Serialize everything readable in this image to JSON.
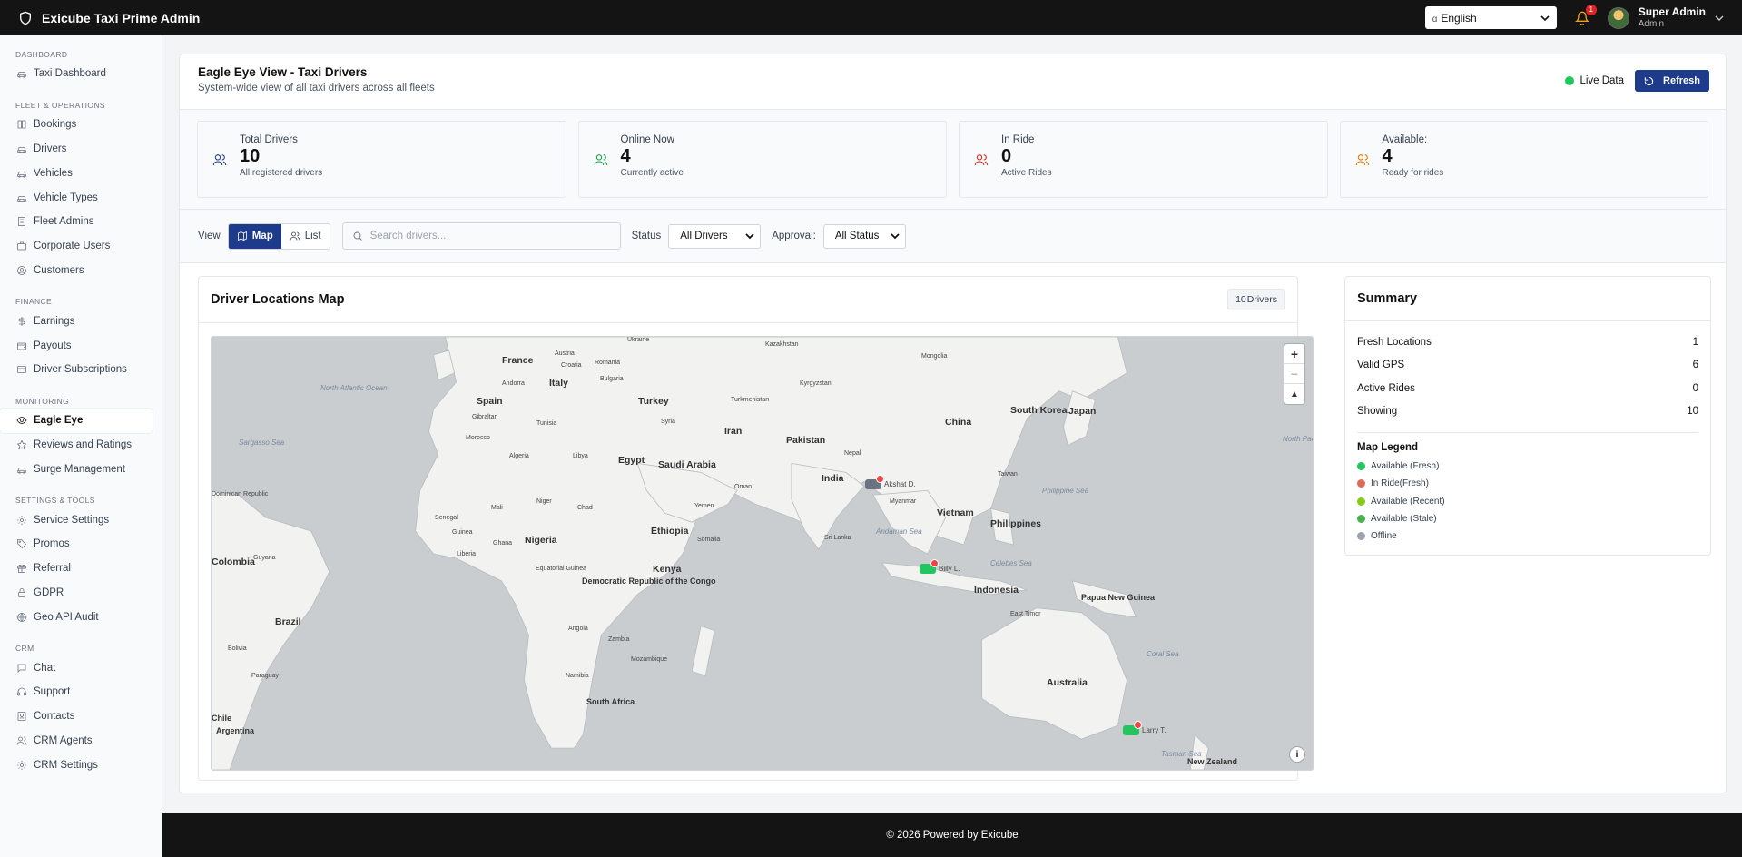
{
  "app": {
    "title": "Exicube Taxi Prime Admin"
  },
  "header": {
    "language": {
      "code": "ɑ",
      "label": "English"
    },
    "notifications_count": "1",
    "user": {
      "name": "Super Admin",
      "role": "Admin"
    }
  },
  "sidebar": {
    "sections": [
      {
        "title": "Dashboard",
        "items": [
          {
            "label": "Taxi Dashboard",
            "icon": "car-icon"
          }
        ]
      },
      {
        "title": "Fleet & Operations",
        "items": [
          {
            "label": "Bookings",
            "icon": "book-icon"
          },
          {
            "label": "Drivers",
            "icon": "car-icon"
          },
          {
            "label": "Vehicles",
            "icon": "car-icon"
          },
          {
            "label": "Vehicle Types",
            "icon": "car-icon"
          },
          {
            "label": "Fleet Admins",
            "icon": "building-icon"
          },
          {
            "label": "Corporate Users",
            "icon": "briefcase-icon"
          },
          {
            "label": "Customers",
            "icon": "user-circle-icon"
          }
        ]
      },
      {
        "title": "Finance",
        "items": [
          {
            "label": "Earnings",
            "icon": "dollar-icon"
          },
          {
            "label": "Payouts",
            "icon": "wallet-icon"
          },
          {
            "label": "Driver Subscriptions",
            "icon": "credit-card-icon"
          }
        ]
      },
      {
        "title": "Monitoring",
        "items": [
          {
            "label": "Eagle Eye",
            "icon": "eye-icon",
            "active": true
          },
          {
            "label": "Reviews and Ratings",
            "icon": "star-icon"
          },
          {
            "label": "Surge Management",
            "icon": "car-icon"
          }
        ]
      },
      {
        "title": "Settings & Tools",
        "items": [
          {
            "label": "Service Settings",
            "icon": "gear-icon"
          },
          {
            "label": "Promos",
            "icon": "tag-icon"
          },
          {
            "label": "Referral",
            "icon": "gift-icon"
          },
          {
            "label": "GDPR",
            "icon": "lock-icon"
          },
          {
            "label": "Geo API Audit",
            "icon": "globe-icon"
          }
        ]
      },
      {
        "title": "CRM",
        "items": [
          {
            "label": "Chat",
            "icon": "chat-icon"
          },
          {
            "label": "Support",
            "icon": "headset-icon"
          },
          {
            "label": "Contacts",
            "icon": "contacts-icon"
          },
          {
            "label": "CRM Agents",
            "icon": "users-icon"
          },
          {
            "label": "CRM Settings",
            "icon": "gear-icon"
          }
        ]
      }
    ]
  },
  "page": {
    "title": "Eagle Eye View - Taxi Drivers",
    "subtitle": "System-wide view of all taxi drivers across all fleets",
    "live_label": "Live Data",
    "refresh_label": "Refresh"
  },
  "stats": [
    {
      "label": "Total Drivers",
      "value": "10",
      "desc": "All registered drivers",
      "color": "#1e3a8a"
    },
    {
      "label": "Online Now",
      "value": "4",
      "desc": "Currently active",
      "color": "#16a34a"
    },
    {
      "label": "In Ride",
      "value": "0",
      "desc": "Active Rides",
      "color": "#dc2626"
    },
    {
      "label": "Available:",
      "value": "4",
      "desc": "Ready for rides",
      "color": "#d97706"
    }
  ],
  "toolbar": {
    "view_label": "View",
    "map_label": "Map",
    "list_label": "List",
    "search_placeholder": "Search drivers...",
    "status_label": "Status",
    "status_value": "All Drivers",
    "approval_label": "Approval:",
    "approval_value": "All Status"
  },
  "map": {
    "title": "Driver Locations Map",
    "count": "10",
    "count_suffix": "Drivers",
    "markers": [
      {
        "label": "Akshat D.",
        "color": "#6b7280"
      },
      {
        "label": "Billy L.",
        "color": "#22c55e"
      },
      {
        "label": "Larry T.",
        "color": "#22c55e"
      }
    ],
    "labels": {
      "france": "France",
      "spain": "Spain",
      "italy": "Italy",
      "turkey": "Turkey",
      "egypt": "Egypt",
      "saudi": "Saudi Arabia",
      "iran": "Iran",
      "pakistan": "Pakistan",
      "india": "India",
      "china": "China",
      "southkorea": "South Korea",
      "japan": "Japan",
      "vietnam": "Vietnam",
      "philippines": "Philippines",
      "indonesia": "Indonesia",
      "australia": "Australia",
      "papua": "Papua New Guinea",
      "nigeria": "Nigeria",
      "ethiopia": "Ethiopia",
      "kenya": "Kenya",
      "drc": "Democratic Republic of the Congo",
      "southafrica": "South Africa",
      "brazil": "Brazil",
      "argentina": "Argentina",
      "algeria": "Algeria",
      "libya": "Libya",
      "mali": "Mali",
      "niger": "Niger",
      "chad": "Chad",
      "angola": "Angola",
      "zambia": "Zambia",
      "namibia": "Namibia",
      "mozambique": "Mozambique",
      "yemen": "Yemen",
      "oman": "Oman",
      "somalia": "Somalia",
      "mongolia": "Mongolia",
      "kazakhstan": "Kazakhstan",
      "myanmar": "Myanmar",
      "srilanka": "Sri Lanka",
      "nepal": "Nepal",
      "eastimor": "East Timor",
      "newzealand": "New Zealand",
      "northatlantic": "North Atlantic Ocean",
      "northpacific": "North Pacific Ocean",
      "sargasso": "Sargasso Sea",
      "andaman": "Andaman Sea",
      "philippinesea": "Philippine Sea",
      "coral": "Coral Sea",
      "tasman": "Tasman Sea",
      "celebes": "Celebes Sea",
      "ukraine": "Ukraine",
      "romania": "Romania",
      "austria": "Austria",
      "croatia": "Croatia",
      "bulgaria": "Bulgaria",
      "andorra": "Andorra",
      "gibraltar": "Gibraltar",
      "morocco": "Morocco",
      "tunisia": "Tunisia",
      "syria": "Syria",
      "turkmenistan": "Turkmenistan",
      "kyrgyzstan": "Kyrgyzstan",
      "taiwan": "Taiwan",
      "senegal": "Senegal",
      "guinea": "Guinea",
      "ghana": "Ghana",
      "liberia": "Liberia",
      "eqguinea": "Equatorial Guinea",
      "guyana": "Guyana",
      "bolivia": "Bolivia",
      "paraguay": "Paraguay",
      "dominican": "Dominican Republic",
      "chile": "Chile",
      "bia": "Colombia"
    }
  },
  "summary": {
    "title": "Summary",
    "rows": [
      {
        "label": "Fresh Locations",
        "value": "1"
      },
      {
        "label": "Valid GPS",
        "value": "6"
      },
      {
        "label": "Active Rides",
        "value": "0"
      },
      {
        "label": "Showing",
        "value": "10"
      }
    ],
    "legend_title": "Map Legend",
    "legend": [
      {
        "label": "Available (Fresh)",
        "color": "#22c55e"
      },
      {
        "label": "In Ride(Fresh)",
        "color": "#dc6b5a"
      },
      {
        "label": "Available (Recent)",
        "color": "#84cc16"
      },
      {
        "label": "Available (Stale)",
        "color": "#4caf50"
      },
      {
        "label": "Offline",
        "color": "#9ca3af"
      }
    ]
  },
  "footer": {
    "text": "© 2026 Powered by Exicube"
  }
}
